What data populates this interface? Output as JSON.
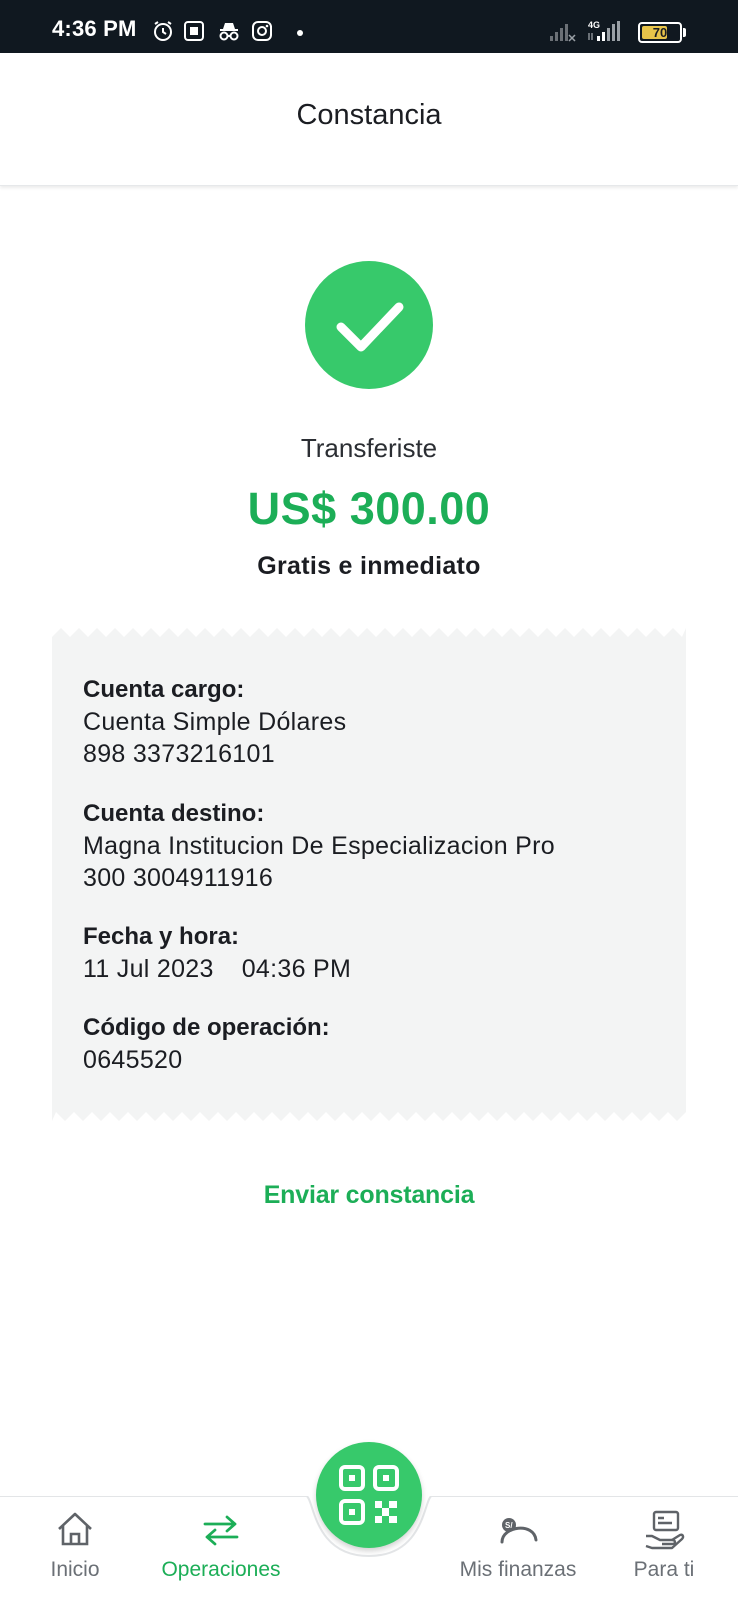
{
  "status_bar": {
    "time": "4:36 PM",
    "network": "4G",
    "battery_level": "70",
    "battery_fraction": 0.7
  },
  "header": {
    "title": "Constancia"
  },
  "summary": {
    "label": "Transferiste",
    "amount": "US$ 300.00",
    "note": "Gratis e inmediato"
  },
  "receipt": {
    "source_account": {
      "label": "Cuenta cargo:",
      "name": "Cuenta Simple Dólares",
      "number": "898 3373216101"
    },
    "destination_account": {
      "label": "Cuenta destino:",
      "name": "Magna Institucion De Especializacion Pro",
      "number": "300 3004911916"
    },
    "datetime": {
      "label": "Fecha y hora:",
      "date": "11 Jul 2023",
      "time": "04:36 PM"
    },
    "operation_code": {
      "label": "Código de operación:",
      "value": "0645520"
    }
  },
  "actions": {
    "send_receipt": "Enviar constancia"
  },
  "bottom_nav": {
    "items": [
      {
        "label": "Inicio",
        "icon": "home-icon",
        "active": false
      },
      {
        "label": "Operaciones",
        "icon": "transfer-arrows-icon",
        "active": true
      },
      {
        "label": "Mis finanzas",
        "icon": "finance-gauge-icon",
        "active": false
      },
      {
        "label": "Para ti",
        "icon": "card-hand-icon",
        "active": false
      }
    ],
    "center_button_icon": "qr-code-icon"
  },
  "colors": {
    "accent": "#1cae57",
    "success": "#37c96b",
    "status_bar": "#101820",
    "receipt_bg": "#f3f4f4"
  }
}
